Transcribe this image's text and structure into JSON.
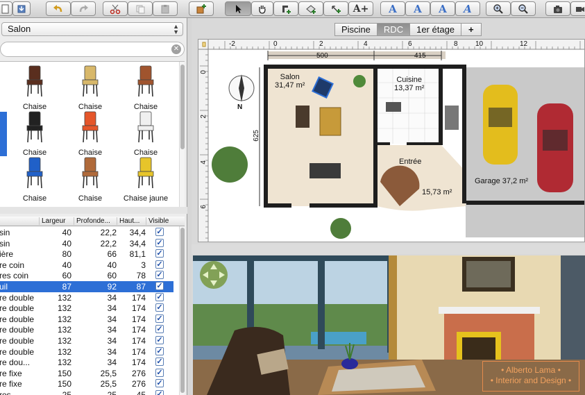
{
  "toolbar": {
    "buttons": [
      "new-furniture",
      "import",
      "undo",
      "redo",
      "cut",
      "copy",
      "paste",
      "add-furniture",
      "select-mode",
      "pan-mode",
      "create-walls",
      "create-rooms",
      "create-dimensions",
      "add-text",
      "text-style",
      "bold-text",
      "modify-text",
      "italic-text",
      "zoom-in",
      "zoom-out",
      "create-photo",
      "create-video"
    ],
    "add_text_glyph": "A+",
    "text_glyph": "A"
  },
  "catalog": {
    "category": "Salon",
    "search_value": "",
    "items": [
      {
        "label": "Chaise",
        "icon": "chair-wood-dark-icon"
      },
      {
        "label": "Chaise",
        "icon": "chair-wood-yellow-icon"
      },
      {
        "label": "Chaise",
        "icon": "chair-wood-brown-icon"
      },
      {
        "label": "Chaise",
        "icon": "chair-black-icon"
      },
      {
        "label": "Chaise",
        "icon": "chair-orange-icon"
      },
      {
        "label": "Chaise",
        "icon": "chair-white-icon"
      },
      {
        "label": "Chaise",
        "icon": "chair-blue-icon"
      },
      {
        "label": "Chaise",
        "icon": "chair-wood-light-icon"
      },
      {
        "label": "Chaise jaune",
        "icon": "chair-yellow-icon"
      }
    ]
  },
  "furniture_table": {
    "columns": [
      "Largeur",
      "Profonde...",
      "Haut...",
      "Visible"
    ],
    "rows": [
      {
        "name": "sin",
        "width": "40",
        "depth": "22,2",
        "height": "34,4",
        "visible": true,
        "selected": false
      },
      {
        "name": "sin",
        "width": "40",
        "depth": "22,2",
        "height": "34,4",
        "visible": true,
        "selected": false
      },
      {
        "name": "ière",
        "width": "80",
        "depth": "66",
        "height": "81,1",
        "visible": true,
        "selected": false
      },
      {
        "name": "re coin",
        "width": "40",
        "depth": "40",
        "height": "3",
        "visible": true,
        "selected": false
      },
      {
        "name": "res coin",
        "width": "60",
        "depth": "60",
        "height": "78",
        "visible": true,
        "selected": false
      },
      {
        "name": "uil",
        "width": "87",
        "depth": "92",
        "height": "87",
        "visible": true,
        "selected": true
      },
      {
        "name": "re double",
        "width": "132",
        "depth": "34",
        "height": "174",
        "visible": true,
        "selected": false
      },
      {
        "name": "re double",
        "width": "132",
        "depth": "34",
        "height": "174",
        "visible": true,
        "selected": false
      },
      {
        "name": "re double",
        "width": "132",
        "depth": "34",
        "height": "174",
        "visible": true,
        "selected": false
      },
      {
        "name": "re double",
        "width": "132",
        "depth": "34",
        "height": "174",
        "visible": true,
        "selected": false
      },
      {
        "name": "re double",
        "width": "132",
        "depth": "34",
        "height": "174",
        "visible": true,
        "selected": false
      },
      {
        "name": "re double",
        "width": "132",
        "depth": "34",
        "height": "174",
        "visible": true,
        "selected": false
      },
      {
        "name": "re dou...",
        "width": "132",
        "depth": "34",
        "height": "174",
        "visible": true,
        "selected": false
      },
      {
        "name": "re fixe",
        "width": "150",
        "depth": "25,5",
        "height": "276",
        "visible": true,
        "selected": false
      },
      {
        "name": "re fixe",
        "width": "150",
        "depth": "25,5",
        "height": "276",
        "visible": true,
        "selected": false
      },
      {
        "name": "res ...",
        "width": "25",
        "depth": "25",
        "height": "45",
        "visible": true,
        "selected": false
      }
    ]
  },
  "levels": {
    "tabs": [
      "Piscine",
      "RDC",
      "1er étage"
    ],
    "active": "RDC",
    "add_label": "+"
  },
  "plan": {
    "ruler_top": [
      "-2",
      "0",
      "2",
      "4",
      "6",
      "8",
      "10",
      "12"
    ],
    "ruler_left": [
      "0",
      "2",
      "4",
      "6"
    ],
    "dimensions": [
      "500",
      "415",
      "625"
    ],
    "rooms": [
      {
        "name": "Salon",
        "area": "31,47 m²"
      },
      {
        "name": "Cuisine",
        "area": "13,37 m²"
      },
      {
        "name": "Entrée",
        "area": "15,73 m²"
      },
      {
        "name": "Garage",
        "area": "37,2 m²"
      }
    ],
    "compass_label": "N"
  },
  "view3d": {
    "watermark_line1": "• Alberto Lama •",
    "watermark_line2": "• Interior and Design •"
  },
  "colors": {
    "selection": "#2d6fd6",
    "wall": "#1e1e1e",
    "living_floor": "#efe4d2",
    "garage_floor": "#c9c9c9",
    "tab_active": "#8d8d8d",
    "watermark": "#f2a25f"
  }
}
